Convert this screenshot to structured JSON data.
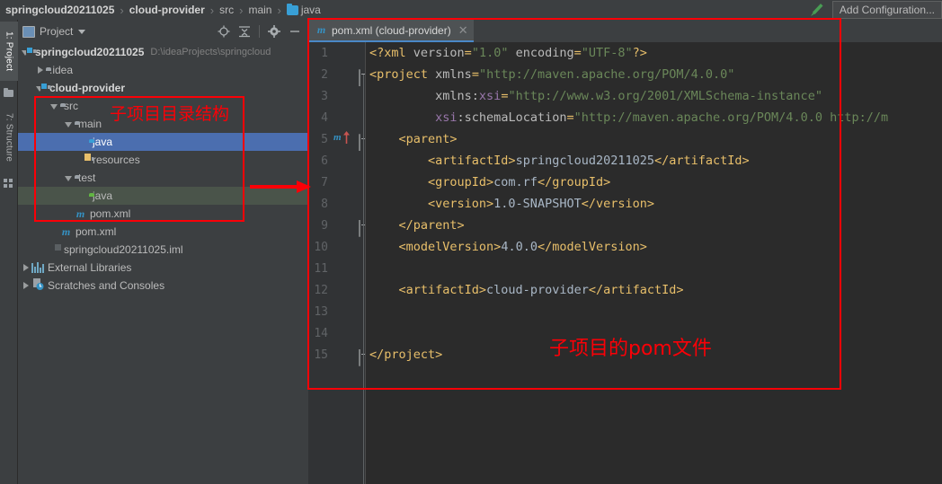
{
  "navbar": {
    "breadcrumbs": [
      {
        "label": "springcloud20211025",
        "bold": true,
        "icon": null
      },
      {
        "label": "cloud-provider",
        "bold": true,
        "icon": null
      },
      {
        "label": "src",
        "bold": false,
        "icon": null
      },
      {
        "label": "main",
        "bold": false,
        "icon": null
      },
      {
        "label": "java",
        "bold": false,
        "icon": "folder-blue-icon"
      }
    ],
    "separator": "›",
    "build_icon": "hammer-icon",
    "add_configuration_label": "Add Configuration..."
  },
  "left_rail": {
    "tabs": [
      {
        "label": "1: Project",
        "active": true,
        "icon": "project-icon"
      },
      {
        "label": "7: Structure",
        "active": false,
        "icon": "structure-icon"
      }
    ]
  },
  "project_panel": {
    "title": "Project",
    "title_icon": "project-window-icon",
    "dropdown_icon": "chevron-down-icon",
    "actions": [
      {
        "name": "scroll-from-source-icon",
        "glyph": "target"
      },
      {
        "name": "collapse-all-icon",
        "glyph": "collapse"
      },
      {
        "name": "settings-gear-icon",
        "glyph": "gear"
      },
      {
        "name": "hide-panel-icon",
        "glyph": "minus"
      }
    ],
    "tree": [
      {
        "label": "springcloud20211025",
        "hint": "D:\\ideaProjects\\springcloud",
        "indent": 0,
        "arrow": "expanded",
        "icon": "module-folder-icon",
        "bold": true,
        "selected": "none"
      },
      {
        "label": ".idea",
        "hint": "",
        "indent": 1,
        "arrow": "collapsed",
        "icon": "folder-icon",
        "bold": false,
        "selected": "none"
      },
      {
        "label": "cloud-provider",
        "hint": "",
        "indent": 1,
        "arrow": "expanded",
        "icon": "module-folder-icon",
        "bold": true,
        "selected": "none"
      },
      {
        "label": "src",
        "hint": "",
        "indent": 2,
        "arrow": "expanded",
        "icon": "folder-icon",
        "bold": false,
        "selected": "none"
      },
      {
        "label": "main",
        "hint": "",
        "indent": 3,
        "arrow": "expanded",
        "icon": "folder-icon",
        "bold": false,
        "selected": "none"
      },
      {
        "label": "java",
        "hint": "",
        "indent": 4,
        "arrow": "none",
        "icon": "source-folder-icon",
        "bold": false,
        "selected": "blue"
      },
      {
        "label": "resources",
        "hint": "",
        "indent": 4,
        "arrow": "none",
        "icon": "resources-folder-icon",
        "bold": false,
        "selected": "none"
      },
      {
        "label": "test",
        "hint": "",
        "indent": 3,
        "arrow": "expanded",
        "icon": "folder-icon",
        "bold": false,
        "selected": "none"
      },
      {
        "label": "java",
        "hint": "",
        "indent": 4,
        "arrow": "none",
        "icon": "test-source-folder-icon",
        "bold": false,
        "selected": "green"
      },
      {
        "label": "pom.xml",
        "hint": "",
        "indent": 3,
        "arrow": "none",
        "icon": "maven-icon",
        "bold": false,
        "selected": "none"
      },
      {
        "label": "pom.xml",
        "hint": "",
        "indent": 2,
        "arrow": "none",
        "icon": "maven-icon",
        "bold": false,
        "selected": "none"
      },
      {
        "label": "springcloud20211025.iml",
        "hint": "",
        "indent": 2,
        "arrow": "none",
        "icon": "iml-file-icon",
        "bold": false,
        "selected": "none"
      },
      {
        "label": "External Libraries",
        "hint": "",
        "indent": 0,
        "arrow": "collapsed",
        "icon": "library-icon",
        "bold": false,
        "selected": "none"
      },
      {
        "label": "Scratches and Consoles",
        "hint": "",
        "indent": 0,
        "arrow": "collapsed",
        "icon": "scratches-icon",
        "bold": false,
        "selected": "none"
      }
    ]
  },
  "editor": {
    "tab": {
      "icon": "maven-icon",
      "label": "pom.xml (cloud-provider)",
      "close_icon": "close-icon"
    },
    "gutter": {
      "maven_parent_marker": "m",
      "maven_parent_arrow_icon": "arrow-up-icon"
    },
    "lines": [
      {
        "n": 1,
        "segments": [
          {
            "t": "punc",
            "s": "<?xml"
          },
          {
            "t": "attr",
            "s": " version"
          },
          {
            "t": "punc",
            "s": "="
          },
          {
            "t": "str",
            "s": "\"1.0\""
          },
          {
            "t": "attr",
            "s": " encoding"
          },
          {
            "t": "punc",
            "s": "="
          },
          {
            "t": "str",
            "s": "\"UTF-8\""
          },
          {
            "t": "punc",
            "s": "?>"
          }
        ]
      },
      {
        "n": 2,
        "segments": [
          {
            "t": "tag",
            "s": "<project"
          },
          {
            "t": "attr",
            "s": " xmlns"
          },
          {
            "t": "punc",
            "s": "="
          },
          {
            "t": "str",
            "s": "\"http://maven.apache.org/POM/4.0.0\""
          }
        ]
      },
      {
        "n": 3,
        "segments": [
          {
            "t": "attr",
            "s": "         xmlns:"
          },
          {
            "t": "ns",
            "s": "xsi"
          },
          {
            "t": "punc",
            "s": "="
          },
          {
            "t": "str",
            "s": "\"http://www.w3.org/2001/XMLSchema-instance\""
          }
        ]
      },
      {
        "n": 4,
        "segments": [
          {
            "t": "ns",
            "s": "         xsi"
          },
          {
            "t": "attr",
            "s": ":schemaLocation"
          },
          {
            "t": "punc",
            "s": "="
          },
          {
            "t": "str",
            "s": "\"http://maven.apache.org/POM/4.0.0 http://m"
          }
        ]
      },
      {
        "n": 5,
        "segments": [
          {
            "t": "tag",
            "s": "    <parent>"
          }
        ]
      },
      {
        "n": 6,
        "segments": [
          {
            "t": "tag",
            "s": "        <artifactId>"
          },
          {
            "t": "txt",
            "s": "springcloud20211025"
          },
          {
            "t": "tag",
            "s": "</artifactId>"
          }
        ]
      },
      {
        "n": 7,
        "segments": [
          {
            "t": "tag",
            "s": "        <groupId>"
          },
          {
            "t": "txt",
            "s": "com.rf"
          },
          {
            "t": "tag",
            "s": "</groupId>"
          }
        ]
      },
      {
        "n": 8,
        "segments": [
          {
            "t": "tag",
            "s": "        <version>"
          },
          {
            "t": "txt",
            "s": "1.0-SNAPSHOT"
          },
          {
            "t": "tag",
            "s": "</version>"
          }
        ]
      },
      {
        "n": 9,
        "segments": [
          {
            "t": "tag",
            "s": "    </parent>"
          }
        ]
      },
      {
        "n": 10,
        "segments": [
          {
            "t": "tag",
            "s": "    <modelVersion>"
          },
          {
            "t": "txt",
            "s": "4.0.0"
          },
          {
            "t": "tag",
            "s": "</modelVersion>"
          }
        ]
      },
      {
        "n": 11,
        "segments": []
      },
      {
        "n": 12,
        "segments": [
          {
            "t": "tag",
            "s": "    <artifactId>"
          },
          {
            "t": "txt",
            "s": "cloud-provider"
          },
          {
            "t": "tag",
            "s": "</artifactId>"
          }
        ]
      },
      {
        "n": 13,
        "segments": []
      },
      {
        "n": 14,
        "segments": []
      },
      {
        "n": 15,
        "segments": [
          {
            "t": "tag",
            "s": "</project>"
          }
        ]
      }
    ]
  },
  "annotations": {
    "color": "#fb0007",
    "sidebar_note": "子项目目录结构",
    "editor_note": "子项目的pom文件",
    "arrow_icon": "right-arrow-annotation"
  }
}
